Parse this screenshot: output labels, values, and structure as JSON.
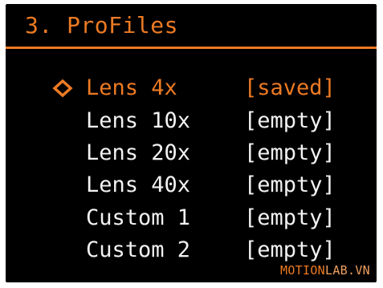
{
  "screen": {
    "title": "3. ProFiles"
  },
  "profiles": [
    {
      "name": "Lens 4x",
      "status": "[saved]",
      "selected": true
    },
    {
      "name": "Lens 10x",
      "status": "[empty]",
      "selected": false
    },
    {
      "name": "Lens 20x",
      "status": "[empty]",
      "selected": false
    },
    {
      "name": "Lens 40x",
      "status": "[empty]",
      "selected": false
    },
    {
      "name": "Custom 1",
      "status": "[empty]",
      "selected": false
    },
    {
      "name": "Custom 2",
      "status": "[empty]",
      "selected": false
    }
  ],
  "cursor_icon": "diamond-outline-icon",
  "watermark": {
    "part1": "MOTION",
    "part2": "LAB.VN"
  },
  "colors": {
    "accent": "#ec7a23",
    "text": "#f2f2f2",
    "background": "#000000"
  }
}
